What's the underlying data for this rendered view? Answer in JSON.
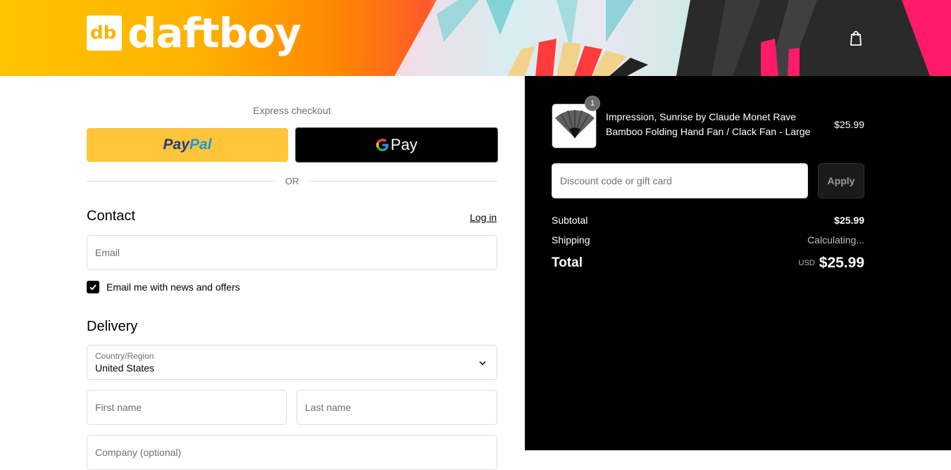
{
  "header": {
    "logo_text": "daftboy",
    "logo_mark": "db",
    "cart_icon": "shopping-bag-icon",
    "colors": {
      "gradient_start": "#ffc400",
      "gradient_mid": "#ff8a00",
      "accent_pink": "#ff1a6a"
    }
  },
  "express": {
    "label": "Express checkout",
    "paypal_part1": "Pay",
    "paypal_part2": "Pal",
    "gpay_g": "G",
    "gpay_label": "Pay",
    "or_label": "OR"
  },
  "contact": {
    "title": "Contact",
    "login_link": "Log in",
    "email_placeholder": "Email",
    "newsletter_label": "Email me with news and offers",
    "newsletter_checked": true
  },
  "delivery": {
    "title": "Delivery",
    "country_label": "Country/Region",
    "country_value": "United States",
    "first_name_placeholder": "First name",
    "last_name_placeholder": "Last name",
    "company_placeholder": "Company (optional)"
  },
  "summary": {
    "item": {
      "quantity": "1",
      "name": "Impression, Sunrise by Claude Monet Rave Bamboo Folding Hand Fan / Clack Fan - Large",
      "price": "$25.99"
    },
    "discount_placeholder": "Discount code or gift card",
    "apply_label": "Apply",
    "subtotal_label": "Subtotal",
    "subtotal_value": "$25.99",
    "shipping_label": "Shipping",
    "shipping_value": "Calculating...",
    "total_label": "Total",
    "total_currency": "USD",
    "total_value": "$25.99"
  }
}
